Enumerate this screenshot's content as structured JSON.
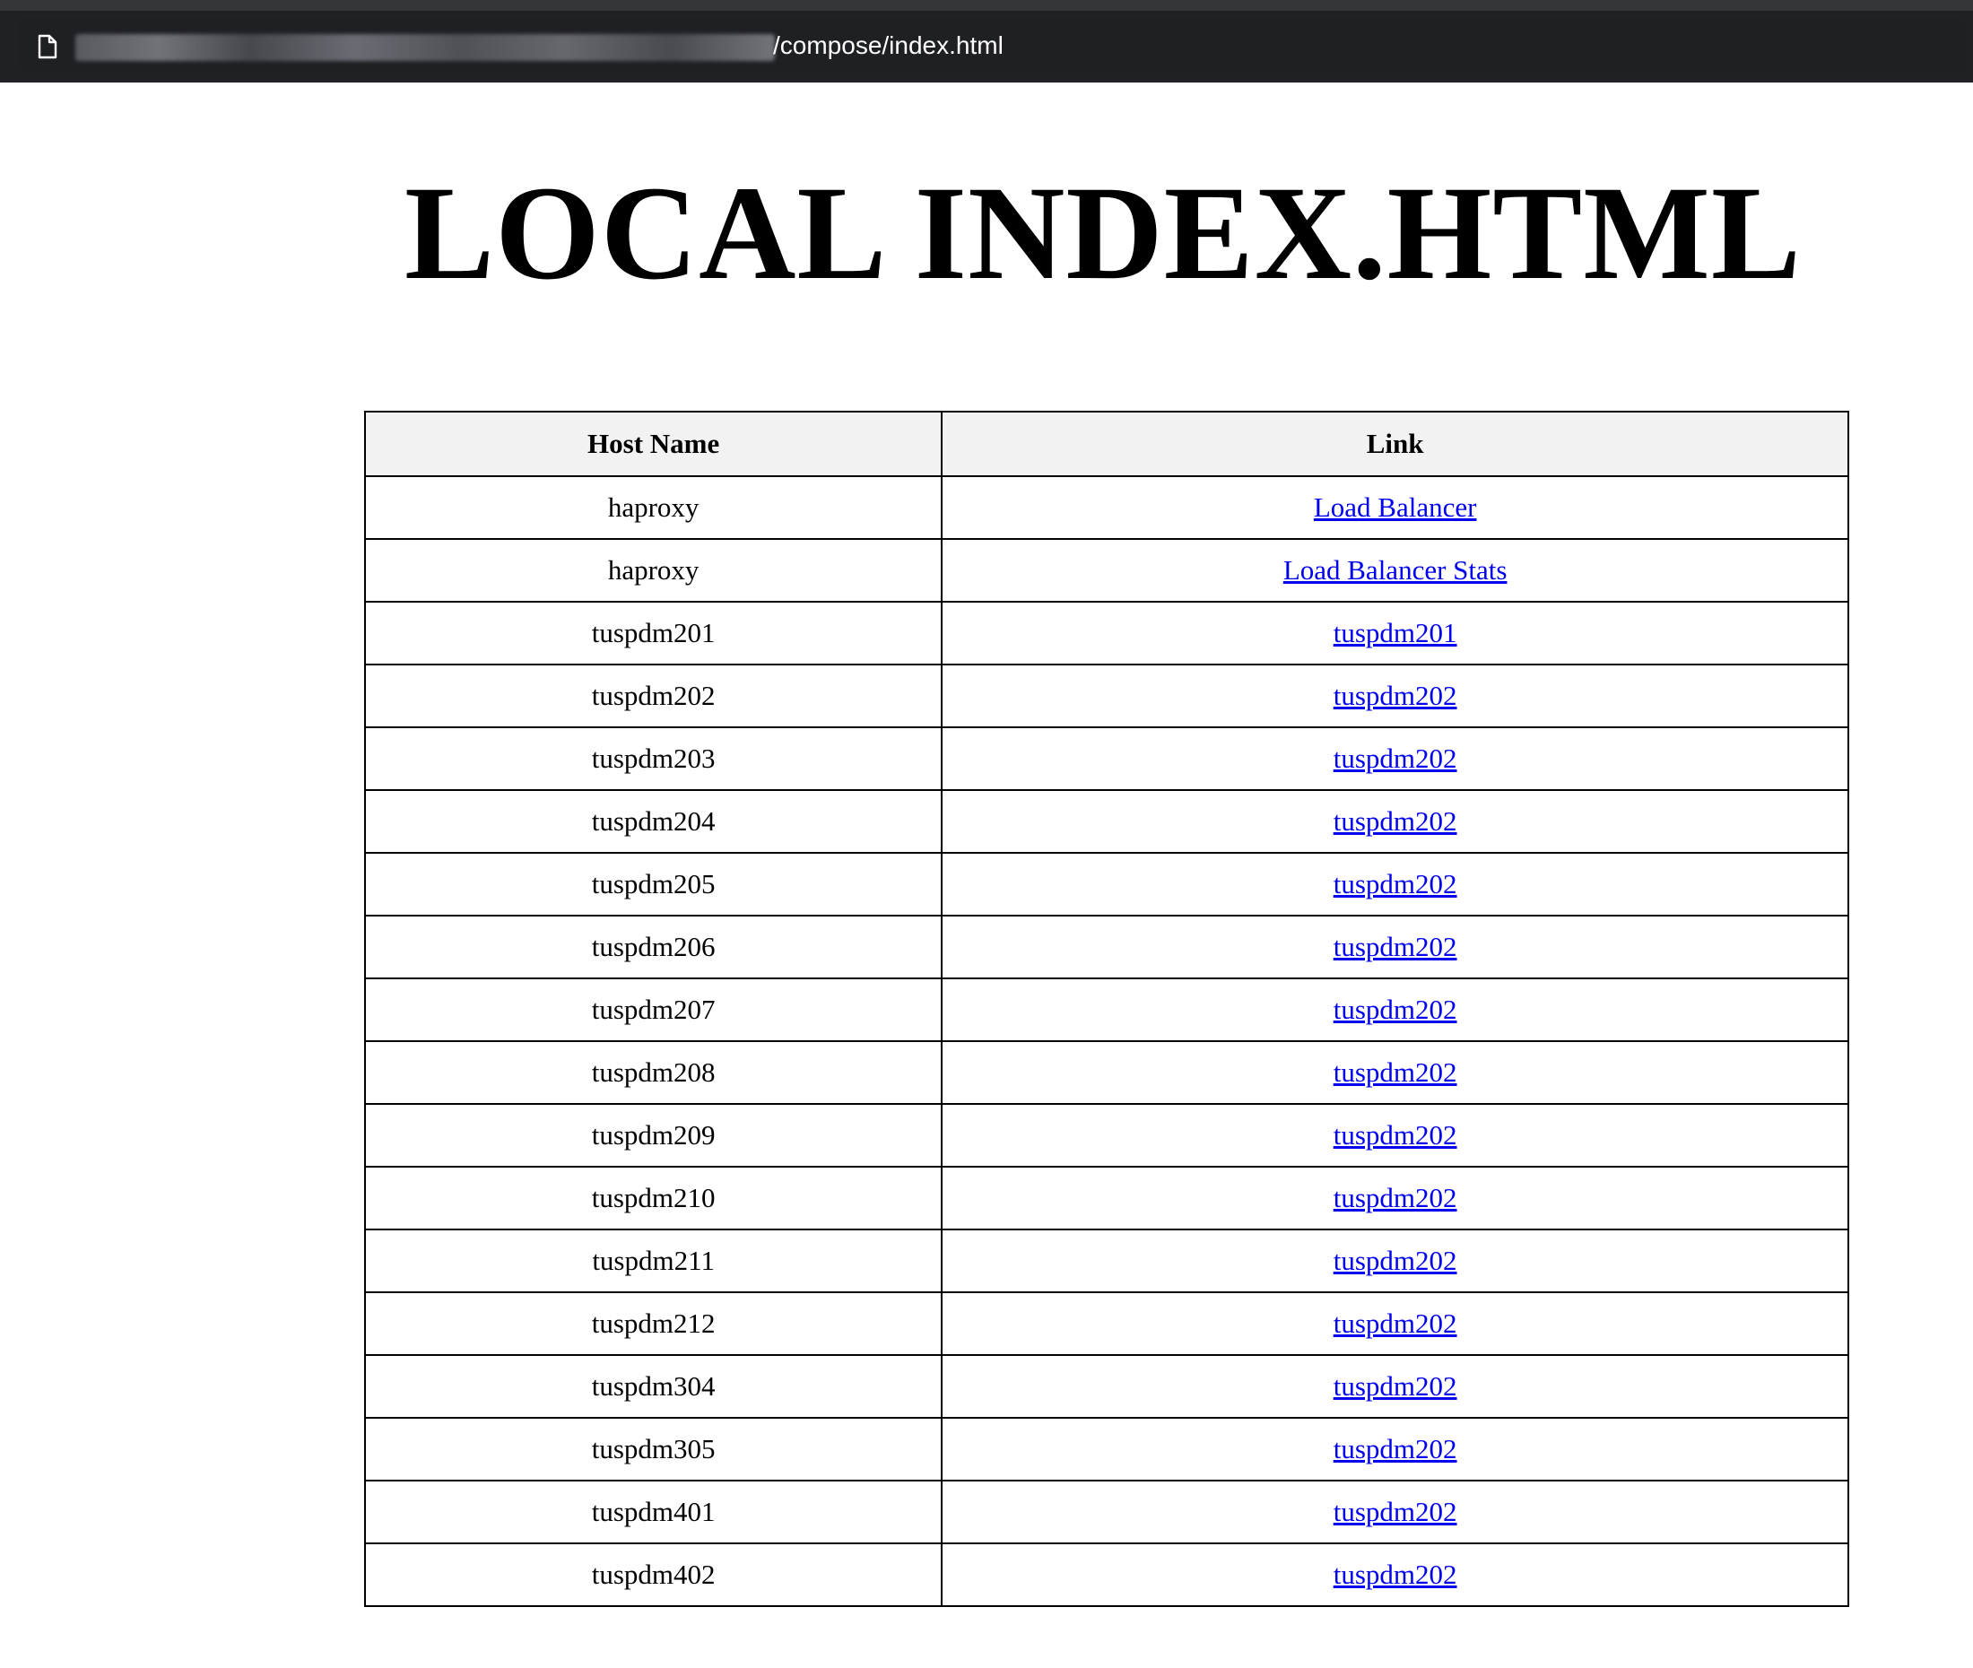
{
  "browser": {
    "url_path": "/compose/index.html",
    "page_icon": "document-icon"
  },
  "page": {
    "title": "LOCAL INDEX.HTML"
  },
  "table": {
    "headers": [
      "Host Name",
      "Link"
    ],
    "rows": [
      {
        "host": "haproxy",
        "link": "Load Balancer"
      },
      {
        "host": "haproxy",
        "link": "Load Balancer Stats"
      },
      {
        "host": "tuspdm201",
        "link": "tuspdm201"
      },
      {
        "host": "tuspdm202",
        "link": "tuspdm202"
      },
      {
        "host": "tuspdm203",
        "link": "tuspdm202"
      },
      {
        "host": "tuspdm204",
        "link": "tuspdm202"
      },
      {
        "host": "tuspdm205",
        "link": "tuspdm202"
      },
      {
        "host": "tuspdm206",
        "link": "tuspdm202"
      },
      {
        "host": "tuspdm207",
        "link": "tuspdm202"
      },
      {
        "host": "tuspdm208",
        "link": "tuspdm202"
      },
      {
        "host": "tuspdm209",
        "link": "tuspdm202"
      },
      {
        "host": "tuspdm210",
        "link": "tuspdm202"
      },
      {
        "host": "tuspdm211",
        "link": "tuspdm202"
      },
      {
        "host": "tuspdm212",
        "link": "tuspdm202"
      },
      {
        "host": "tuspdm304",
        "link": "tuspdm202"
      },
      {
        "host": "tuspdm305",
        "link": "tuspdm202"
      },
      {
        "host": "tuspdm401",
        "link": "tuspdm202"
      },
      {
        "host": "tuspdm402",
        "link": "tuspdm202"
      }
    ]
  },
  "colors": {
    "link": "#0000ee",
    "header_bg": "#f2f2f2",
    "browser_bar": "#202124"
  }
}
